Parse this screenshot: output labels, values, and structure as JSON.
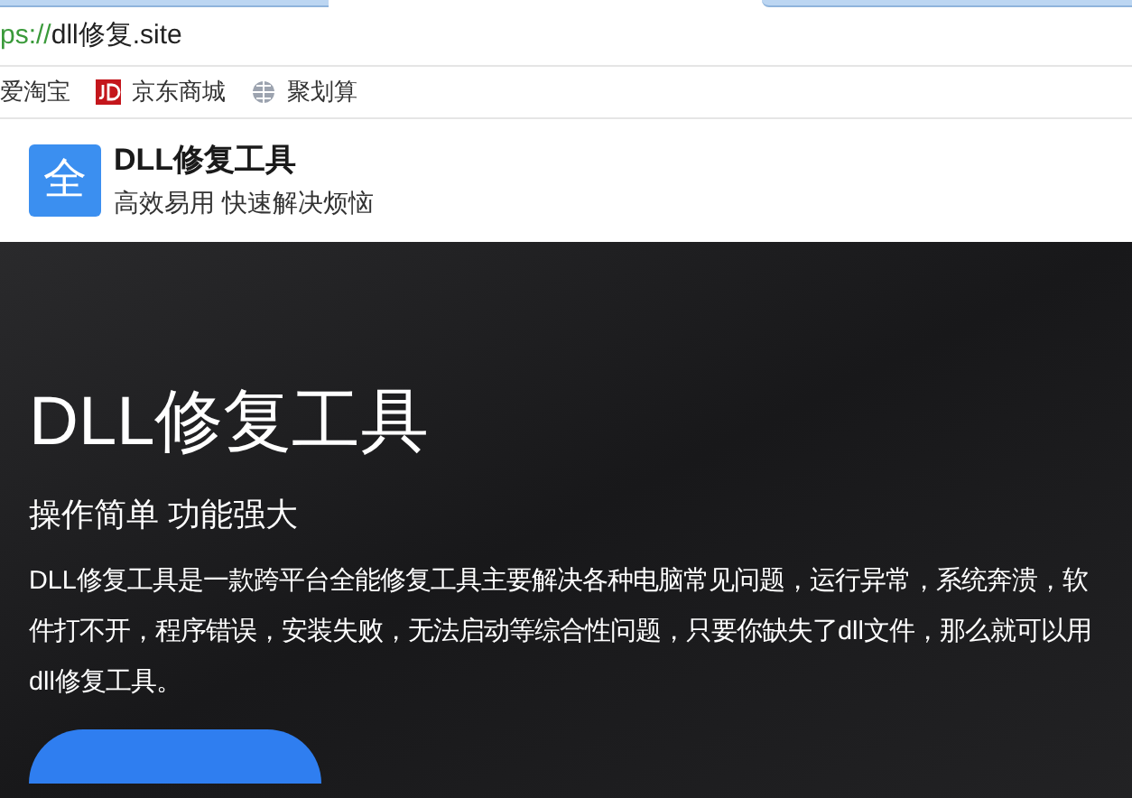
{
  "address_bar": {
    "scheme": "ps://",
    "url": "dll修复.site"
  },
  "bookmarks": [
    {
      "label": "爱淘宝",
      "kind": "plain"
    },
    {
      "label": "京东商城",
      "kind": "jd"
    },
    {
      "label": "聚划算",
      "kind": "globe"
    }
  ],
  "site_header": {
    "logo": "全",
    "title": "DLL修复工具",
    "tagline": "高效易用 快速解决烦恼"
  },
  "hero": {
    "title": "DLL修复工具",
    "subtitle": "操作简单 功能强大",
    "description": "DLL修复工具是一款跨平台全能修复工具主要解决各种电脑常见问题，运行异常，系统奔溃，软件打不开，程序错误，安装失败，无法启动等综合性问题，只要你缺失了dll文件，那么就可以用dll修复工具。"
  }
}
